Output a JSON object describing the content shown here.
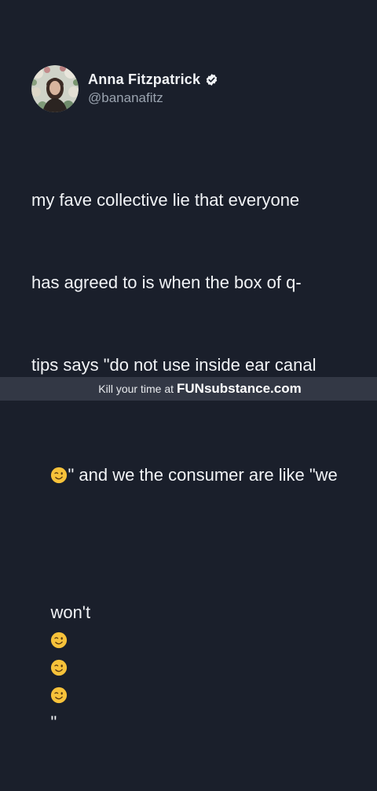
{
  "tweet": {
    "display_name": "Anna Fitzpatrick",
    "handle": "@bananafitz",
    "lines": [
      "my fave collective lie that everyone",
      "has agreed to is when the box of q-",
      "tips says \"do not use inside ear canal",
      "\" and we the consumer are like \"we",
      "won't",
      "\""
    ],
    "emoji": "winking-face"
  },
  "footer": {
    "prefix": "Kill your time at",
    "brand": "FUNsubstance.com"
  },
  "colors": {
    "background": "#1a1f2b",
    "text": "#f2f4f7",
    "handle": "#9aa3af",
    "verified": "#f1f3f6",
    "footer_bg": "#333845"
  }
}
